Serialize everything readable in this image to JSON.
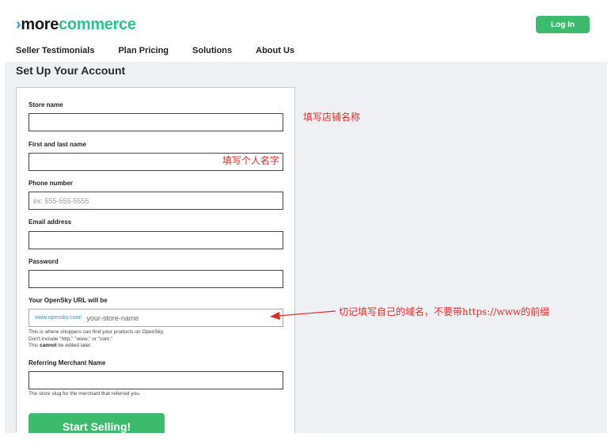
{
  "header": {
    "logo_chevron": "›",
    "logo_part1": "more",
    "logo_part2": "commerce",
    "login_label": "Log In"
  },
  "nav": {
    "items": [
      "Seller Testimonials",
      "Plan Pricing",
      "Solutions",
      "About Us"
    ]
  },
  "page": {
    "title": "Set Up Your Account"
  },
  "form": {
    "store_name_label": "Store name",
    "name_label": "First and last name",
    "phone_label": "Phone number",
    "phone_placeholder": "ex: 555-555-5555",
    "email_label": "Email address",
    "password_label": "Password",
    "url_label": "Your OpenSky URL will be",
    "url_prefix": "www.opensky.com/",
    "url_placeholder": "your-store-name",
    "url_help_1": "This is where shoppers can find your products on OpenSky.",
    "url_help_2": "Don't include \"http,\" \"www,\" or \"com.\"",
    "url_help_3a": "This ",
    "url_help_3b": "cannot",
    "url_help_3c": " be edited later.",
    "merchant_label": "Referring Merchant Name",
    "merchant_help": "The store slug for the merchant that referred you.",
    "submit_label": "Start Selling!"
  },
  "annotations": {
    "store_name": "填写店铺名称",
    "personal_name": "填写个人名字",
    "domain": "切记填写自己的域名，不要带https://www的前缀"
  },
  "colors": {
    "accent_green": "#3dbb6d",
    "logo_teal": "#2dc38d",
    "annotation_red": "#e02b2b"
  }
}
